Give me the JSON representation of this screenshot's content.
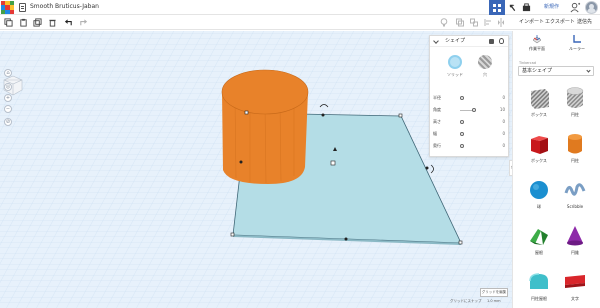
{
  "app": {
    "title": "Smooth Bruticus-Jaban",
    "logo_colors": [
      "#e53935",
      "#fbc02d",
      "#43a047",
      "#1e88e5",
      "#e53935",
      "#fbc02d",
      "#43a047",
      "#1e88e5",
      "#e53935"
    ]
  },
  "topnav": {
    "new_design": "新規作",
    "grid_active": true
  },
  "toolbar": {
    "import_label": "インポート",
    "export_label": "エクスポート",
    "share_label": "送信先"
  },
  "shape_panel": {
    "title": "シェイプ",
    "solid_label": "ソリッド",
    "hole_label": "穴",
    "params": [
      {
        "label": "半径",
        "value": "0",
        "fill": 0.0
      },
      {
        "label": "角度",
        "value": "10",
        "fill": 0.2
      },
      {
        "label": "高さ",
        "value": "0",
        "fill": 0.0
      },
      {
        "label": "幅",
        "value": "0",
        "fill": 0.0
      },
      {
        "label": "奥行",
        "value": "0",
        "fill": 0.0
      }
    ]
  },
  "sidebar": {
    "tools": [
      {
        "label": "作業平面",
        "icon": "workplane-icon"
      },
      {
        "label": "ルーラー",
        "icon": "ruler-icon"
      }
    ],
    "library_caption": "Tinkercad",
    "library_value": "基本シェイプ",
    "shapes": [
      {
        "label": "ボックス",
        "icon": "box-hole-icon"
      },
      {
        "label": "円柱",
        "icon": "cylinder-hole-icon"
      },
      {
        "label": "ボックス",
        "icon": "box-icon"
      },
      {
        "label": "円柱",
        "icon": "cylinder-icon"
      },
      {
        "label": "球",
        "icon": "sphere-icon"
      },
      {
        "label": "Scribble",
        "icon": "scribble-icon"
      },
      {
        "label": "屋根",
        "icon": "roof-icon"
      },
      {
        "label": "円錐",
        "icon": "cone-icon"
      },
      {
        "label": "円柱屋根",
        "icon": "round-roof-icon"
      },
      {
        "label": "文字",
        "icon": "text-icon"
      }
    ]
  },
  "bottom": {
    "grid_settings": "グリッドを編集",
    "snap_label": "グリッドにスナップ",
    "snap_value": "1.0 mm"
  },
  "colors": {
    "accent": "#3a67b8",
    "cylinder": "#e8822a",
    "workplane_shape": "#b4dde6",
    "grid_bg": "#e7f1fb"
  }
}
